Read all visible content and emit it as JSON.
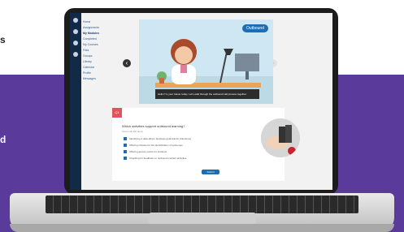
{
  "page": {
    "left_text_top": "s",
    "left_text_mid": "d"
  },
  "app": {
    "sidebar": {
      "nav_items": [
        {
          "label": "Home",
          "active": false
        },
        {
          "label": "Assignments",
          "active": false
        },
        {
          "label": "My Modules",
          "active": true
        },
        {
          "label": "Completed",
          "active": false
        },
        {
          "label": "My Courses",
          "active": false
        },
        {
          "label": "Files",
          "active": false
        },
        {
          "label": "Groups",
          "active": false
        },
        {
          "label": "Library",
          "active": false
        },
        {
          "label": "Calendar",
          "active": false
        },
        {
          "label": "Profile",
          "active": false
        },
        {
          "label": "Messages",
          "active": false
        }
      ]
    },
    "hero": {
      "tag": "Outbound",
      "caption": "Hello! I'm your trainer today. Let's walk through the outbound call process together."
    },
    "navigation": {
      "prev_icon": "‹",
      "next_icon": "›"
    },
    "quiz": {
      "badge": "Q1",
      "question": "Which activities support outbound learning?",
      "subtitle": "Select all that apply",
      "options": [
        "Identifying a data-driven business goal and its milestones",
        "Offering choices for the identification of outcomes",
        "Offering access points for students",
        "Checking for feedback on outbound content activities"
      ],
      "submit_label": "Submit"
    }
  },
  "colors": {
    "purple_band": "#5a3a9a",
    "sidebar": "#122a45",
    "accent": "#1f6db1",
    "quiz_badge": "#e0545e"
  }
}
